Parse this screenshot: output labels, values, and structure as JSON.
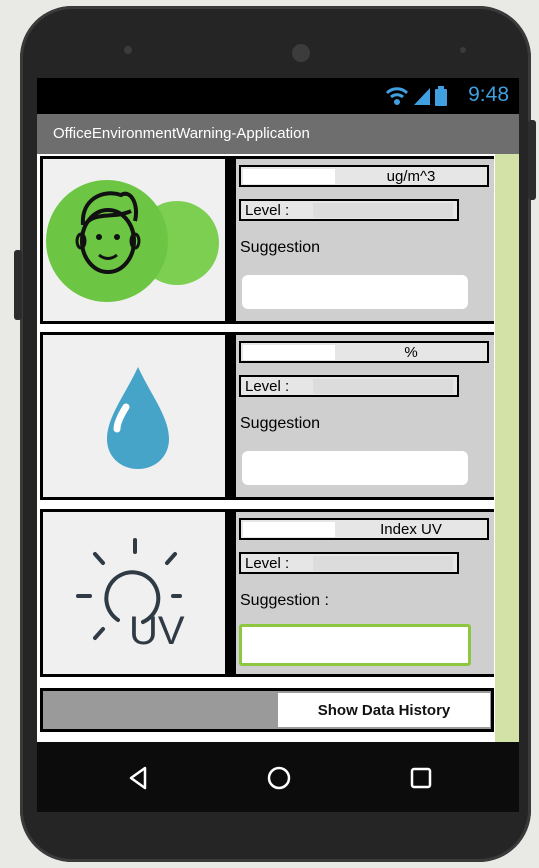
{
  "status": {
    "time": "9:48"
  },
  "app": {
    "title": "OfficeEnvironmentWarning-Application"
  },
  "rows": [
    {
      "icon": "face-icon",
      "unit": "ug/m^3",
      "level_label": "Level :",
      "suggestion_label": "Suggestion"
    },
    {
      "icon": "water-drop-icon",
      "unit": "%",
      "level_label": "Level :",
      "suggestion_label": "Suggestion"
    },
    {
      "icon": "sun-uv-icon",
      "icon_text": "UV",
      "unit": "Index UV",
      "level_label": "Level :",
      "suggestion_label": "Suggestion :"
    }
  ],
  "history_button": {
    "label": "Show Data History"
  },
  "navbar": {
    "back": "back-icon",
    "home": "home-icon",
    "recents": "recents-icon"
  },
  "colors": {
    "status_accent": "#3f9fe0",
    "titlebar": "#6e6e6e",
    "green_strip": "#d3e2a6",
    "focus_border": "#8dc63f"
  }
}
